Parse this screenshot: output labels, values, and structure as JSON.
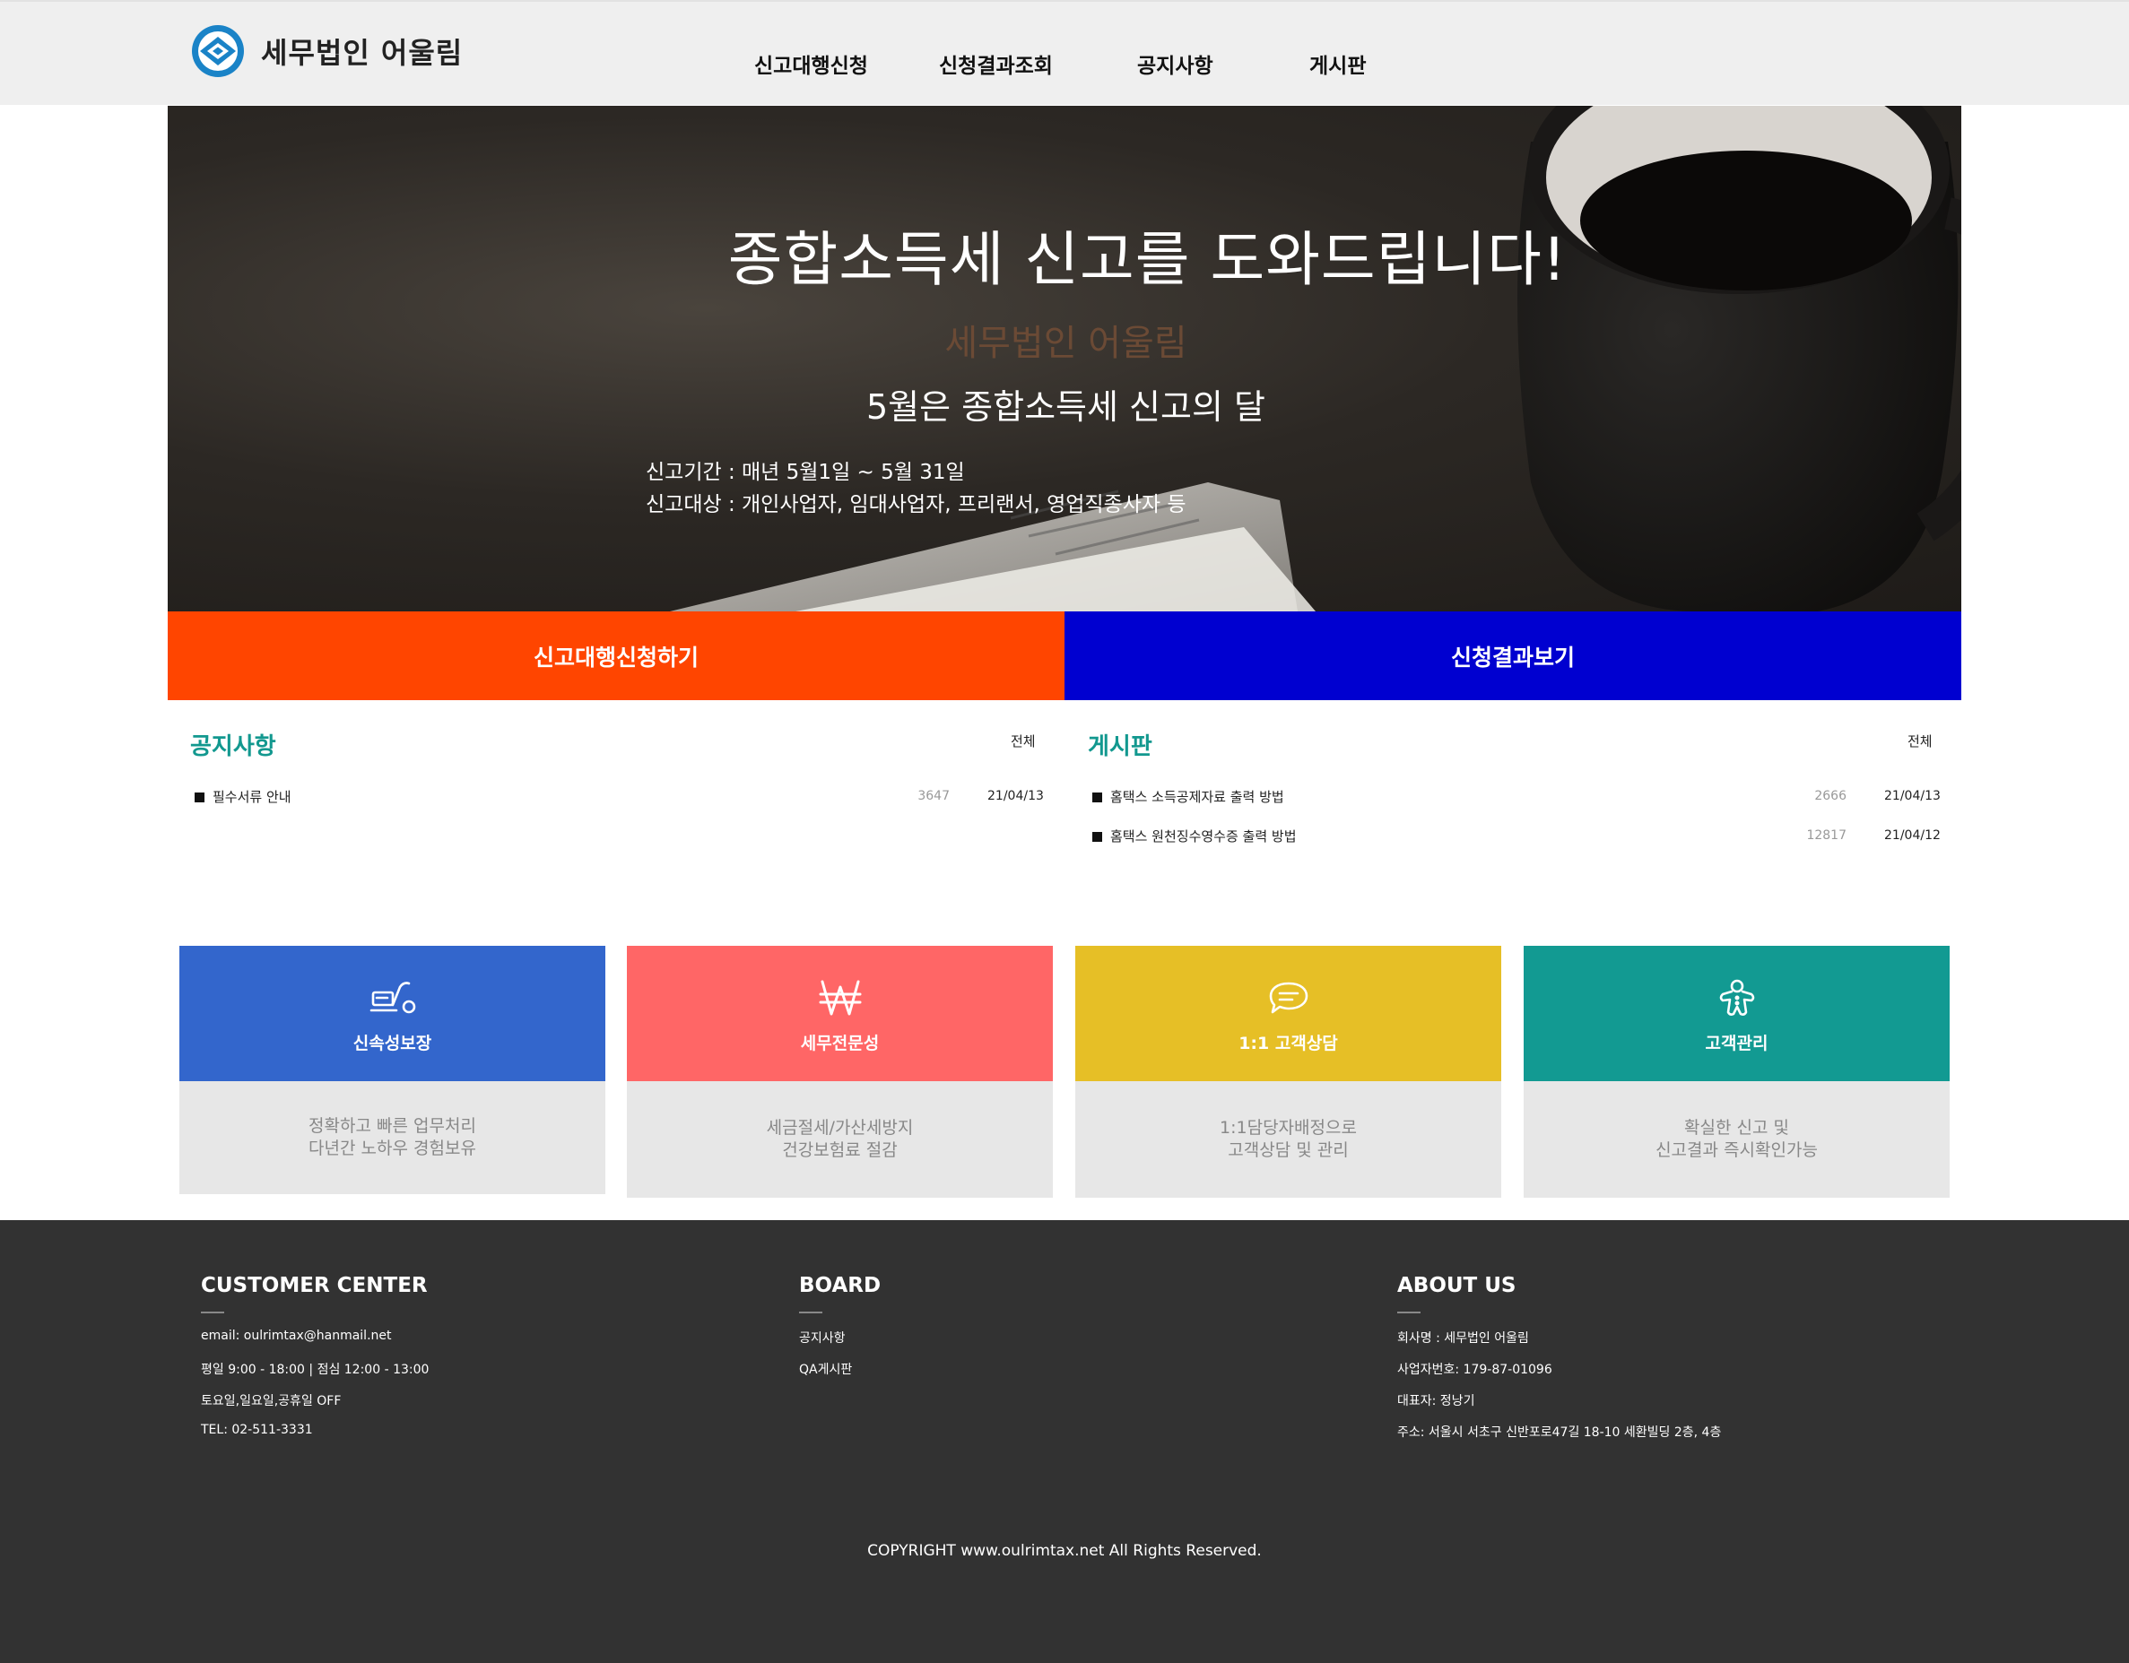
{
  "brand": {
    "name": "세무법인 어울림",
    "color": "#1a83c7"
  },
  "nav": {
    "items": [
      "신고대행신청",
      "신청결과조회",
      "공지사항",
      "게시판"
    ]
  },
  "hero": {
    "title": "종합소득세 신고를 도와드립니다!",
    "company": "세무법인 어울림",
    "subtitle": "5월은 종합소득세 신고의 달",
    "period": "신고기간 : 매년 5월1일 ~ 5월 31일",
    "target": "신고대상 : 개인사업자, 임대사업자, 프리랜서, 영업직종사자 등"
  },
  "cta": {
    "apply_label": "신고대행신청하기",
    "apply_color": "#ff4500",
    "result_label": "신청결과보기",
    "result_color": "#0000d0"
  },
  "notice": {
    "title": "공지사항",
    "more": "전체",
    "rows": [
      {
        "title": "필수서류 안내",
        "views": "3647",
        "date": "21/04/13"
      }
    ]
  },
  "board": {
    "title": "게시판",
    "more": "전체",
    "rows": [
      {
        "title": "홈택스 소득공제자료 출력 방법",
        "views": "2666",
        "date": "21/04/13"
      },
      {
        "title": "홈택스 원천징수영수증 출력 방법",
        "views": "12817",
        "date": "21/04/12"
      }
    ]
  },
  "features": [
    {
      "icon": "truck-icon",
      "title": "신속성보장",
      "color": "#3366cc",
      "lines": [
        "정확하고 빠른 업무처리",
        "다년간 노하우 경험보유"
      ]
    },
    {
      "icon": "won-icon",
      "title": "세무전문성",
      "color": "#ff6666",
      "lines": [
        "세금절세/가산세방지",
        "건강보험료 절감"
      ]
    },
    {
      "icon": "chat-bubble-icon",
      "title": "1:1 고객상담",
      "color": "#e6bf26",
      "lines": [
        "1:1담당자배정으로",
        "고객상담 및 관리"
      ]
    },
    {
      "icon": "gingerbread-icon",
      "title": "고객관리",
      "color": "#129a92",
      "lines": [
        "확실한 신고 및",
        "신고결과 즉시확인가능"
      ]
    }
  ],
  "footer": {
    "customer": {
      "title": "CUSTOMER CENTER",
      "lines": [
        "email: oulrimtax@hanmail.net",
        "평일 9:00 - 18:00 | 점심 12:00 - 13:00",
        "토요일,일요일,공휴일 OFF",
        "TEL: 02-511-3331"
      ]
    },
    "board": {
      "title": "BOARD",
      "links": [
        "공지사항",
        "QA게시판"
      ]
    },
    "about": {
      "title": "ABOUT US",
      "lines": [
        "회사명 : 세무법인 어울림",
        "사업자번호: 179-87-01096",
        "대표자: 정낭기",
        "주소: 서울시 서초구 신반포로47길 18-10 세환빌딩 2층, 4층"
      ]
    },
    "copyright": "COPYRIGHT www.oulrimtax.net All Rights Reserved."
  }
}
